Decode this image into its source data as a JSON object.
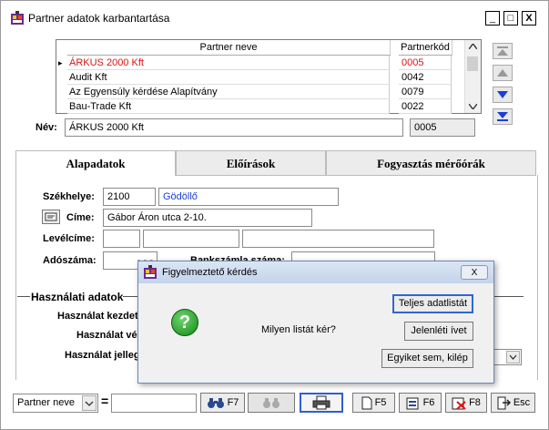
{
  "window": {
    "title": "Partner adatok karbantartása",
    "min": "_",
    "max": "□",
    "close": "X"
  },
  "grid": {
    "headers": [
      "Partner neve",
      "Partnerkód"
    ],
    "rows": [
      {
        "name": "ÁRKUS 2000 Kft",
        "code": "0005",
        "selected": true
      },
      {
        "name": "Audit Kft",
        "code": "0042"
      },
      {
        "name": "Az Egyensúly kérdése Alapítvány",
        "code": "0079"
      },
      {
        "name": "Bau-Trade Kft",
        "code": "0022"
      }
    ],
    "row_marker": "▸"
  },
  "nev": {
    "label": "Név:",
    "value": "ÁRKUS 2000 Kft",
    "code": "0005"
  },
  "tabs": [
    "Alapadatok",
    "Előírások",
    "Fogyasztás mérőórák"
  ],
  "address": {
    "szekhely_label": "Székhelye:",
    "zip": "2100",
    "city": "Gödöllő",
    "cime_label": "Címe:",
    "street": "Gábor Áron utca 2-10.",
    "levelcim_label": "Levélcíme:",
    "adoszam_label": "Adószáma:",
    "adoszam_value": "- - -",
    "bankszamla_label": "Bankszámla száma:"
  },
  "usage": {
    "group_label": "Használati adatok",
    "kezdete": "Használat kezdete:",
    "vege": "Használat vége:",
    "jellege": "Használat jellege:"
  },
  "dialog": {
    "title": "Figyelmeztető kérdés",
    "close": "X",
    "question": "Milyen listát kér?",
    "buttons": [
      "Teljes adatlistát",
      "Jelenléti ívet",
      "Egyiket sem, kilép"
    ],
    "icon": "?"
  },
  "bottom": {
    "combo_value": "Partner neve",
    "eq": "=",
    "search_value": "",
    "buttons": [
      {
        "label": "F7",
        "icon": "binoculars-icon"
      },
      {
        "label": "",
        "icon": "binoculars-disabled-icon"
      },
      {
        "label": "",
        "icon": "printer-icon"
      },
      {
        "label": "F5",
        "icon": "new-document-icon"
      },
      {
        "label": "F6",
        "icon": "edit-document-icon"
      },
      {
        "label": "F8",
        "icon": "delete-document-icon"
      },
      {
        "label": "Esc",
        "icon": "exit-icon"
      }
    ]
  }
}
